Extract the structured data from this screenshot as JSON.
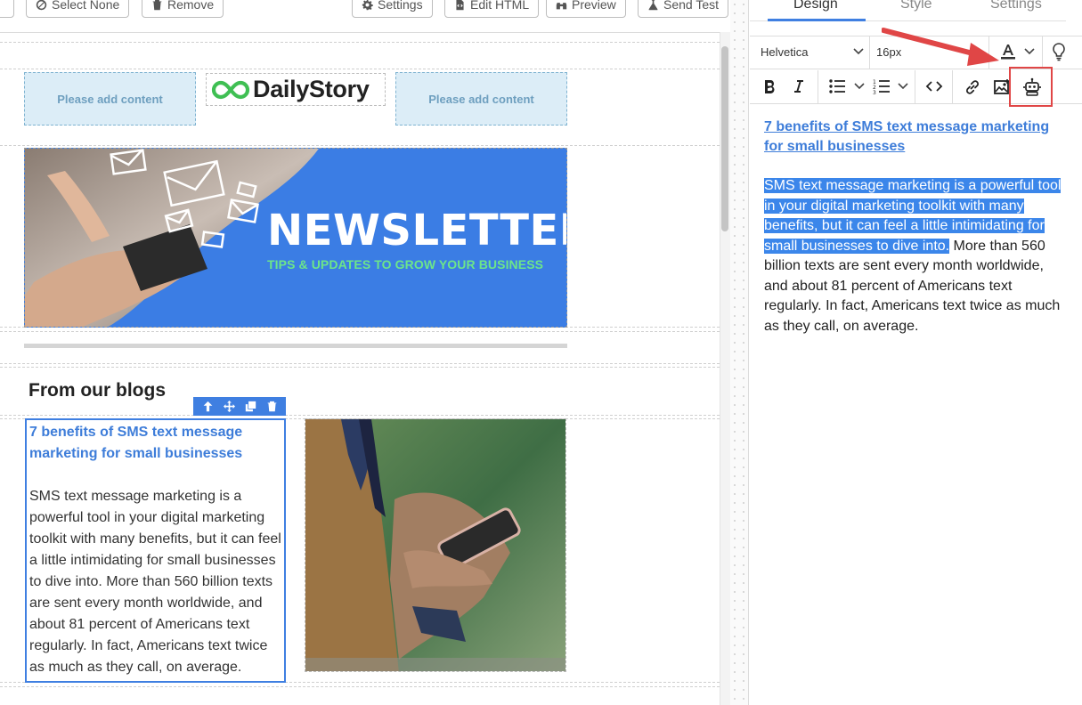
{
  "toolbar": {
    "select_none": "Select None",
    "remove": "Remove",
    "settings": "Settings",
    "edit_html": "Edit HTML",
    "preview": "Preview",
    "send_test": "Send Test"
  },
  "canvas": {
    "placeholder_left": "Please add content",
    "placeholder_right": "Please add content",
    "logo_text": "DailyStory",
    "banner_title": "NEWSLETTER",
    "banner_subtitle": "TIPS & UPDATES TO GROW YOUR BUSINESS",
    "section_heading": "From our blogs",
    "blog_link": "7 benefits of SMS text message marketing for small businesses",
    "blog_body": "SMS text message marketing is a powerful tool in your digital marketing toolkit with many benefits, but it can feel a little intimidating for small businesses to dive into. More than 560 billion texts are sent every month worldwide, and about 81 percent of Americans text regularly. In fact, Americans text twice as much as they call, on average."
  },
  "panel": {
    "tabs": [
      "Design",
      "Style",
      "Settings"
    ],
    "active_tab": "Design",
    "font_family": "Helvetica",
    "font_size": "16px",
    "editor": {
      "link": "7 benefits of SMS text message marketing for small businesses",
      "selected_text": "SMS text message marketing is a powerful tool in your digital marketing toolkit with many benefits, but it can feel a little intimidating for small businesses to dive into.",
      "rest_text": " More than 560 billion texts are sent every month worldwide, and about 81 percent of Americans text regularly. In fact, Americans text twice as much as they call, on average."
    }
  },
  "colors": {
    "accent": "#3f7fe1",
    "banner": "#3b7de4",
    "banner_subtitle": "#6ce58a",
    "annotation": "#e04646",
    "selection": "#3b86ea"
  },
  "icons": [
    "circle-slash-icon",
    "trash-icon",
    "gear-icon",
    "code-file-icon",
    "binoculars-icon",
    "flask-icon",
    "arrow-up-icon",
    "move-icon",
    "duplicate-icon",
    "chevron-down-icon",
    "text-color-icon",
    "lightbulb-icon",
    "bold-icon",
    "italic-icon",
    "bullet-list-icon",
    "numbered-list-icon",
    "code-icon",
    "link-icon",
    "image-icon",
    "robot-icon"
  ]
}
